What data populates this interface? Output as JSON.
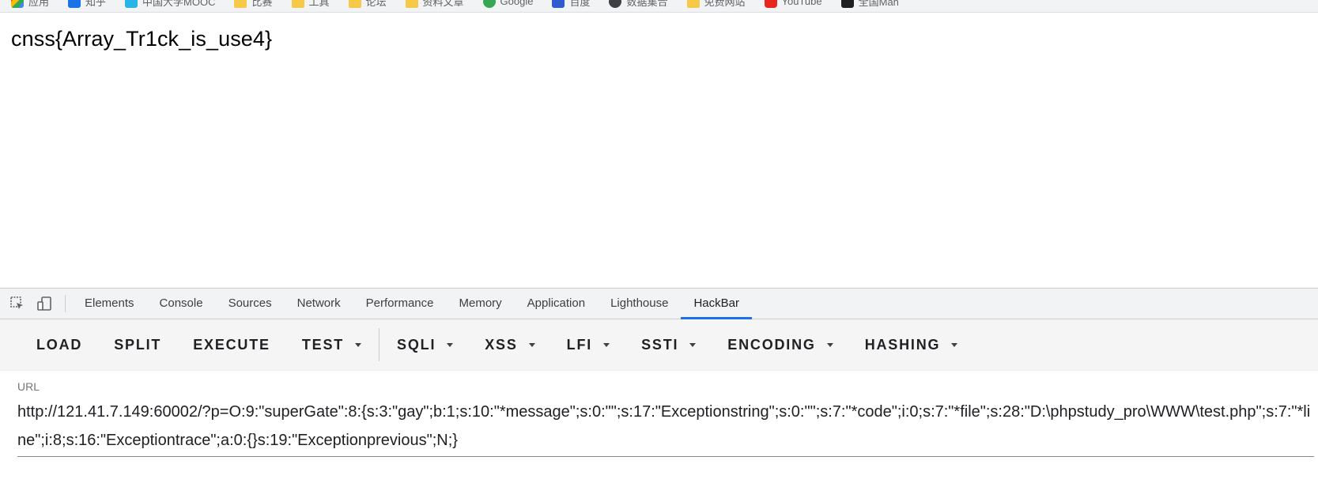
{
  "bookmarks": [
    {
      "label": "应用",
      "icon": "apps-icon",
      "color": "#4285f4"
    },
    {
      "label": "知乎",
      "icon": "zhihu-icon",
      "color": "#1a73e8"
    },
    {
      "label": "中国大学MOOC",
      "icon": "mooc-icon",
      "color": "#27b5e8"
    },
    {
      "label": "比赛",
      "icon": "folder-icon",
      "color": "#f7c948"
    },
    {
      "label": "工具",
      "icon": "folder-icon",
      "color": "#f7c948"
    },
    {
      "label": "论坛",
      "icon": "folder-icon",
      "color": "#f7c948"
    },
    {
      "label": "资料文章",
      "icon": "folder-icon",
      "color": "#f7c948"
    },
    {
      "label": "Google",
      "icon": "google-icon",
      "color": "#34a853"
    },
    {
      "label": "百度",
      "icon": "baidu-icon",
      "color": "#2f5bd1"
    },
    {
      "label": "数据集合",
      "icon": "github-icon",
      "color": "#3c4043"
    },
    {
      "label": "免费网站",
      "icon": "folder-icon",
      "color": "#f7c948"
    },
    {
      "label": "YouTube",
      "icon": "youtube-icon",
      "color": "#e8261b"
    },
    {
      "label": "全国Man",
      "icon": "site-icon",
      "color": "#1f1f1f"
    }
  ],
  "page": {
    "text": "cnss{Array_Tr1ck_is_use4}"
  },
  "devtools": {
    "tabs": [
      "Elements",
      "Console",
      "Sources",
      "Network",
      "Performance",
      "Memory",
      "Application",
      "Lighthouse",
      "HackBar"
    ],
    "active_tab": "HackBar",
    "accent": "#1a73e8"
  },
  "hackbar": {
    "buttons": [
      {
        "label": "LOAD",
        "dropdown": false
      },
      {
        "label": "SPLIT",
        "dropdown": false
      },
      {
        "label": "EXECUTE",
        "dropdown": false
      },
      {
        "label": "TEST",
        "dropdown": true
      },
      {
        "label": "SQLI",
        "dropdown": true
      },
      {
        "label": "XSS",
        "dropdown": true
      },
      {
        "label": "LFI",
        "dropdown": true
      },
      {
        "label": "SSTI",
        "dropdown": true
      },
      {
        "label": "ENCODING",
        "dropdown": true
      },
      {
        "label": "HASHING",
        "dropdown": true
      }
    ],
    "url_label": "URL",
    "url_value": "http://121.41.7.149:60002/?p=O:9:\"superGate\":8:{s:3:\"gay\";b:1;s:10:\"*message\";s:0:\"\";s:17:\"Exceptionstring\";s:0:\"\";s:7:\"*code\";i:0;s:7:\"*file\";s:28:\"D:\\phpstudy_pro\\WWW\\test.php\";s:7:\"*line\";i:8;s:16:\"Exceptiontrace\";a:0:{}s:19:\"Exceptionprevious\";N;}"
  }
}
